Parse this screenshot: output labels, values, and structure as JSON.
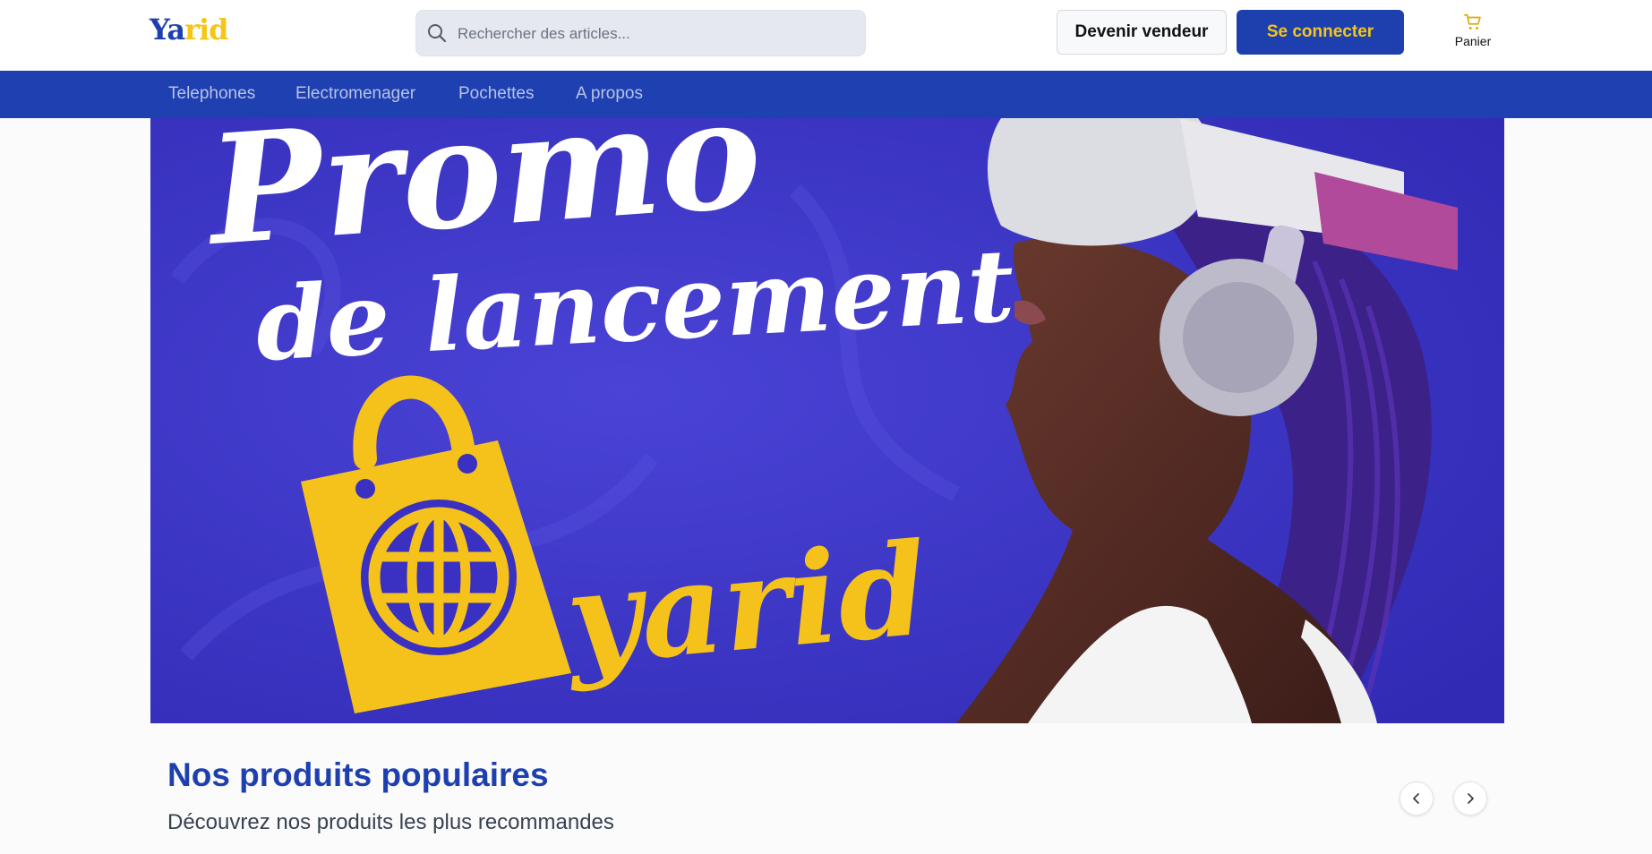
{
  "header": {
    "logo": {
      "part1": "Ya",
      "part2": "rid"
    },
    "search": {
      "placeholder": "Rechercher des articles...",
      "value": ""
    },
    "become_seller_label": "Devenir vendeur",
    "login_label": "Se connecter",
    "cart_label": "Panier"
  },
  "nav": {
    "items": [
      {
        "label": "Telephones"
      },
      {
        "label": "Electromenager"
      },
      {
        "label": "Pochettes"
      },
      {
        "label": "A propos"
      }
    ]
  },
  "banner": {
    "line1": "Promo",
    "line2": "de lancement",
    "brand": "yarid"
  },
  "section": {
    "title": "Nos produits populaires",
    "subtitle": "Découvrez nos produits les plus recommandes"
  },
  "colors": {
    "brand_blue": "#1e40af",
    "brand_yellow": "#f5c518",
    "banner_bg": "#3a30c2"
  },
  "icons": [
    "search-icon",
    "cart-icon",
    "chevron-left-icon",
    "chevron-right-icon",
    "shopping-bag-icon",
    "globe-icon"
  ]
}
